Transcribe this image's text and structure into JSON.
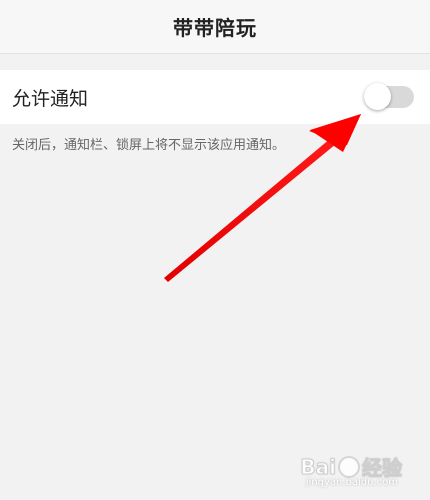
{
  "header": {
    "title": "带带陪玩"
  },
  "settings": {
    "allow_notifications": {
      "label": "允许通知",
      "enabled": false
    },
    "hint": "关闭后，通知栏、锁屏上将不显示该应用通知。"
  },
  "watermark": {
    "brand_left": "Bai",
    "brand_right": "经验",
    "url": "jingyan.baidu.com"
  },
  "colors": {
    "arrow": "#ff0000",
    "toggle_off": "#d9d9d9"
  }
}
